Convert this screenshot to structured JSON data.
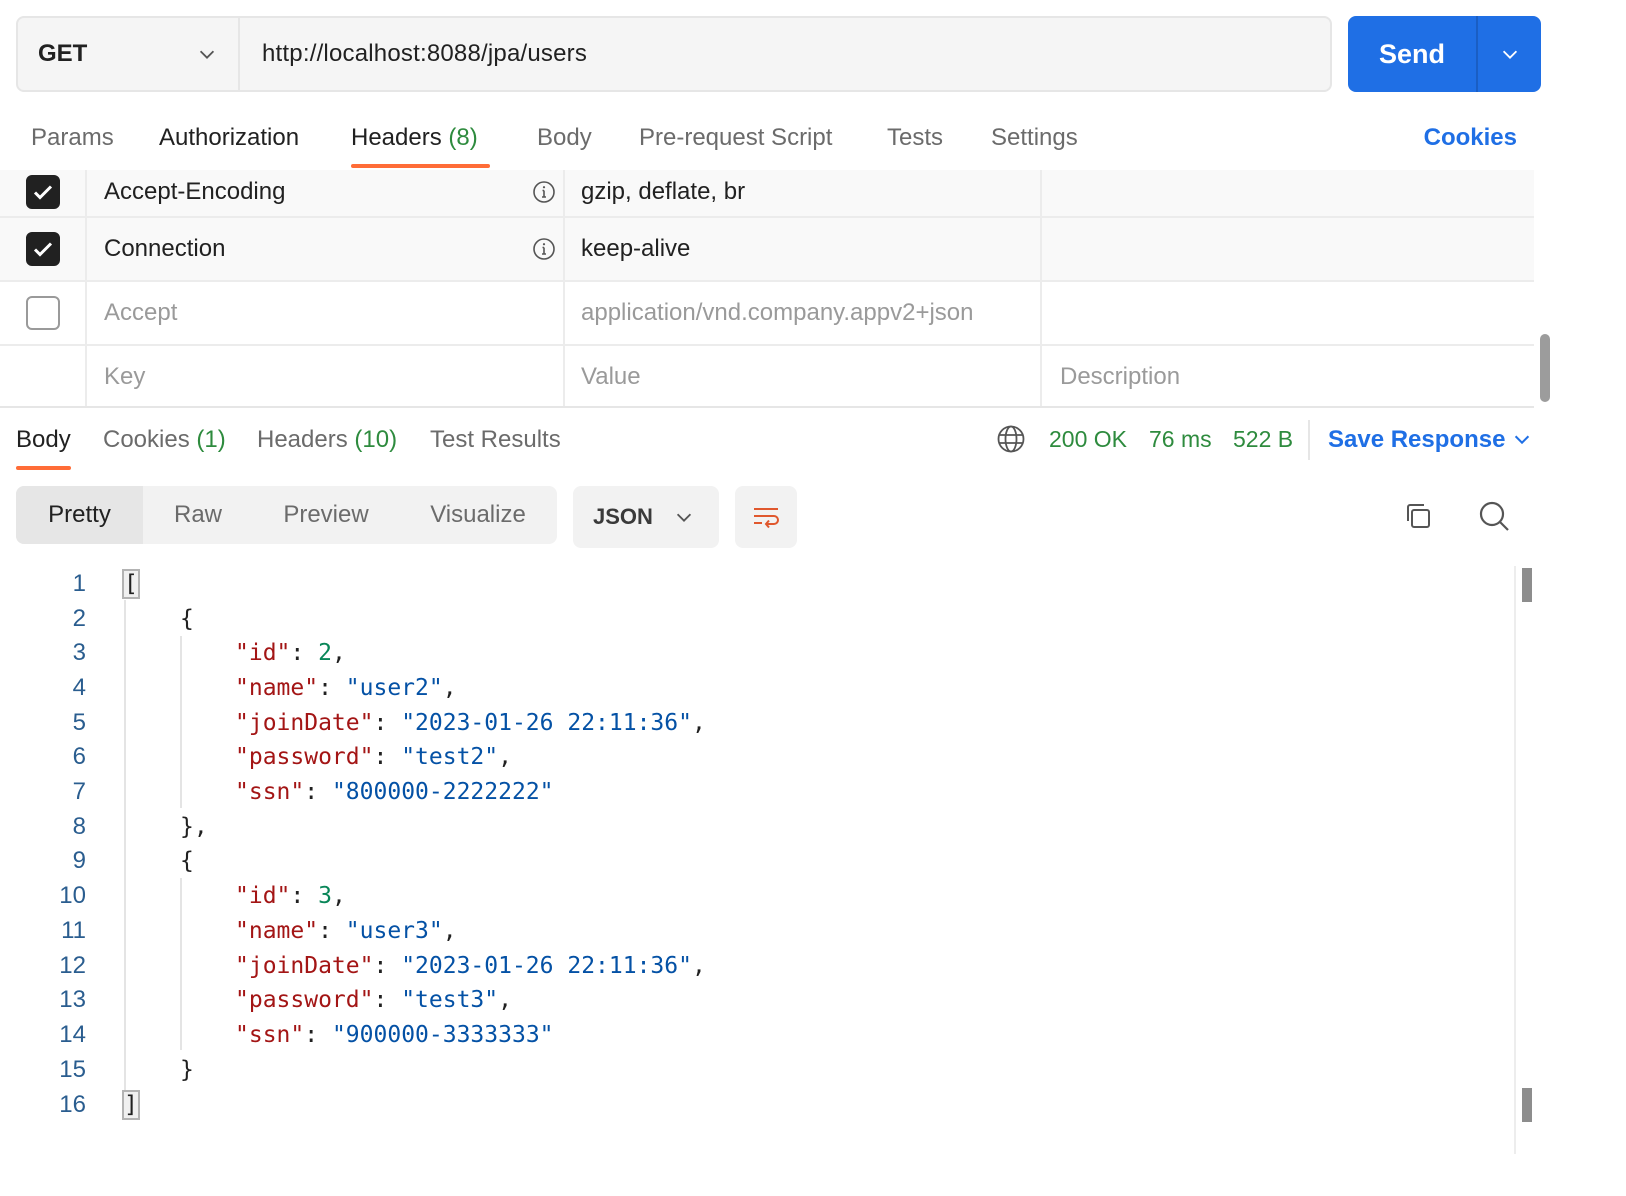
{
  "request": {
    "method": "GET",
    "url": "http://localhost:8088/jpa/users",
    "send_label": "Send"
  },
  "request_tabs": [
    {
      "label": "Params"
    },
    {
      "label": "Authorization"
    },
    {
      "label": "Headers",
      "count": "(8)"
    },
    {
      "label": "Body"
    },
    {
      "label": "Pre-request Script"
    },
    {
      "label": "Tests"
    },
    {
      "label": "Settings"
    }
  ],
  "cookies_link": "Cookies",
  "headers_table": {
    "rows": [
      {
        "checked": true,
        "key": "Accept-Encoding",
        "value": "gzip, deflate, br"
      },
      {
        "checked": true,
        "key": "Connection",
        "value": "keep-alive"
      },
      {
        "checked": false,
        "key": "Accept",
        "value": "application/vnd.company.appv2+json"
      }
    ],
    "new_row": {
      "key_placeholder": "Key",
      "value_placeholder": "Value",
      "description_placeholder": "Description"
    }
  },
  "response": {
    "tabs": [
      {
        "label": "Body"
      },
      {
        "label": "Cookies",
        "count": "(1)"
      },
      {
        "label": "Headers",
        "count": "(10)"
      },
      {
        "label": "Test Results"
      }
    ],
    "status": "200 OK",
    "time": "76 ms",
    "size": "522 B",
    "save_label": "Save Response",
    "views": [
      "Pretty",
      "Raw",
      "Preview",
      "Visualize"
    ],
    "format": "JSON"
  },
  "colors": {
    "accent": "#1f6fe5",
    "tab_indicator": "#ff6c37",
    "status_ok": "#2e8b3e"
  },
  "code_lines": [
    {
      "n": "1"
    },
    {
      "n": "2"
    },
    {
      "n": "3"
    },
    {
      "n": "4"
    },
    {
      "n": "5"
    },
    {
      "n": "6"
    },
    {
      "n": "7"
    },
    {
      "n": "8"
    },
    {
      "n": "9"
    },
    {
      "n": "10"
    },
    {
      "n": "11"
    },
    {
      "n": "12"
    },
    {
      "n": "13"
    },
    {
      "n": "14"
    },
    {
      "n": "15"
    },
    {
      "n": "16"
    }
  ],
  "json_body": {
    "open_array": "[",
    "close_array": "]",
    "users": [
      {
        "id": "2",
        "name": "\"user2\"",
        "joinDate": "\"2023-01-26 22:11:36\"",
        "password": "\"test2\"",
        "ssn": "\"800000-2222222\"",
        "close": "},"
      },
      {
        "id": "3",
        "name": "\"user3\"",
        "joinDate": "\"2023-01-26 22:11:36\"",
        "password": "\"test3\"",
        "ssn": "\"900000-3333333\"",
        "close": "}"
      }
    ],
    "keys": {
      "id": "\"id\"",
      "name": "\"name\"",
      "joinDate": "\"joinDate\"",
      "password": "\"password\"",
      "ssn": "\"ssn\""
    }
  }
}
